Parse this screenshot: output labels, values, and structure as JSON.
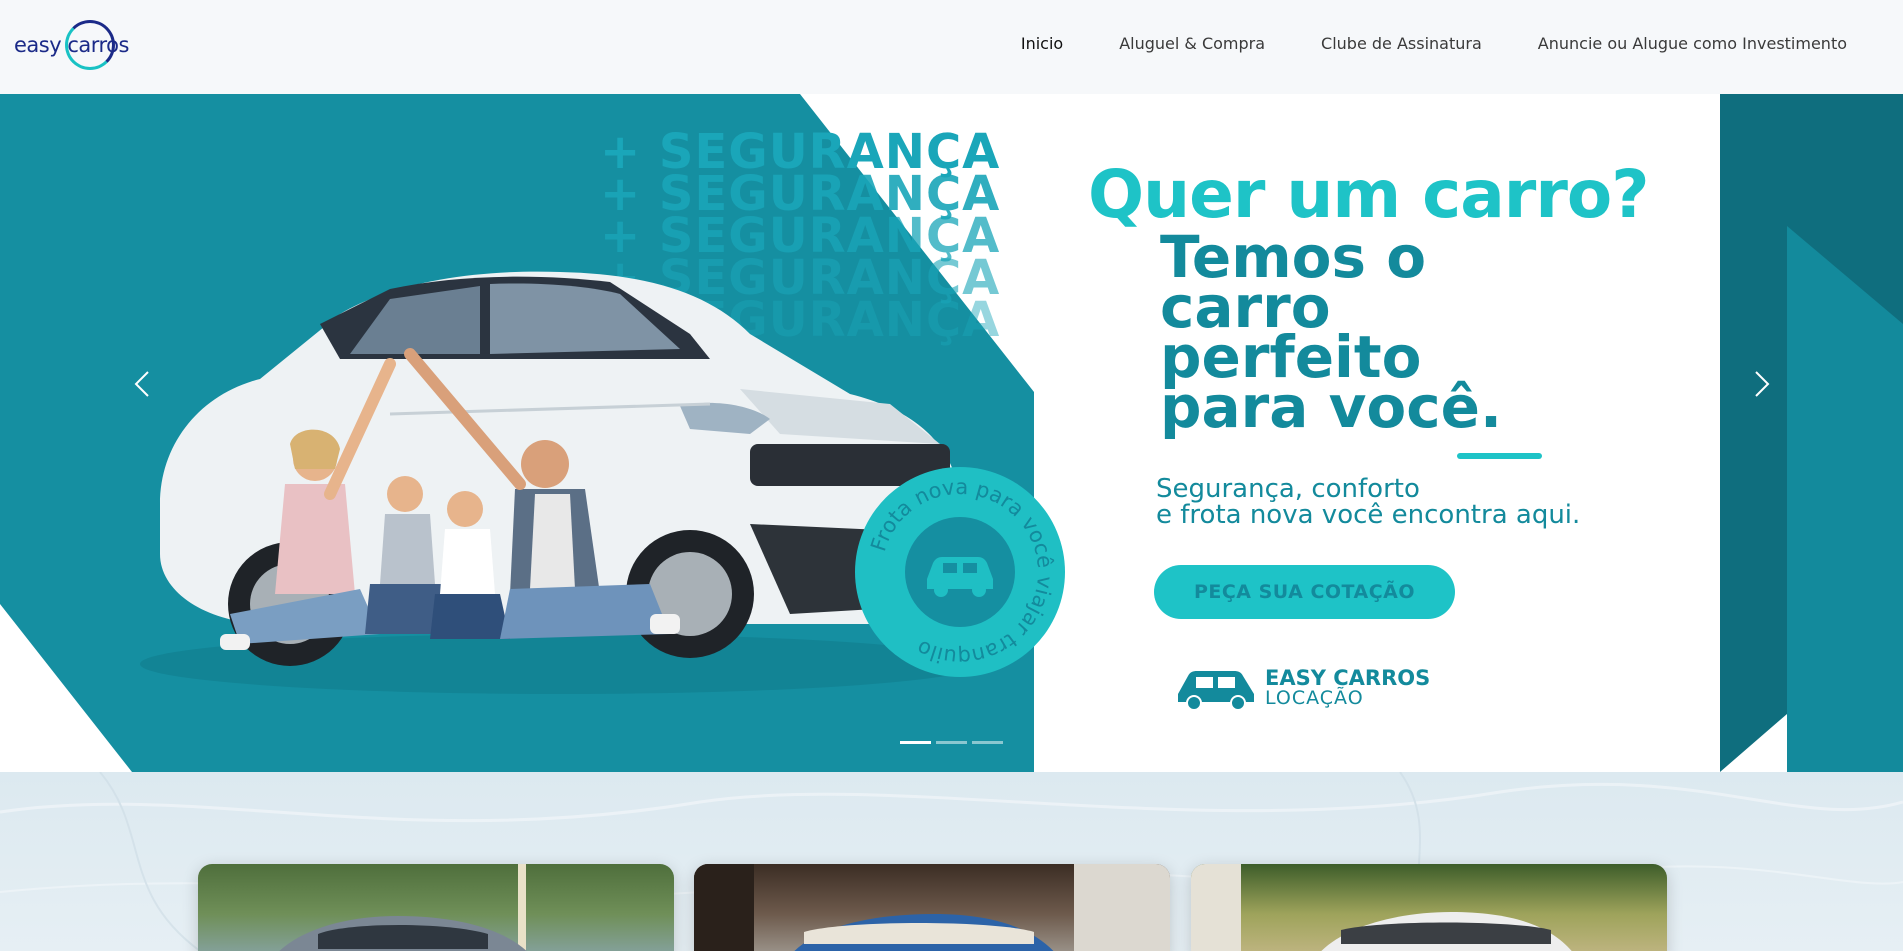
{
  "header": {
    "logo_text": "easy carros",
    "nav": [
      "Inicio",
      "Aluguel & Compra",
      "Clube de Assinatura",
      "Anuncie ou Alugue como Investimento"
    ]
  },
  "hero": {
    "repeat_word": "+ SEGURANÇA",
    "headline_1": "Quer um carro?",
    "headline_2": "Temos o\ncarro\nperfeito\npara você.",
    "subtext": "Segurança, conforto\ne frota nova você encontra aqui.",
    "cta_label": "PEÇA SUA COTAÇÃO",
    "badge_text": "Frota nova para você viajar tranquilo",
    "brand_name": "EASY CARROS",
    "brand_sub": "LOCAÇÃO",
    "slides_total": 3,
    "active_slide": 1
  },
  "colors": {
    "teal_dark": "#158fa1",
    "teal_light": "#1ec3c7",
    "navy": "#1b2a88"
  },
  "icons": [
    "chevron-left-icon",
    "chevron-right-icon",
    "car-icon"
  ]
}
